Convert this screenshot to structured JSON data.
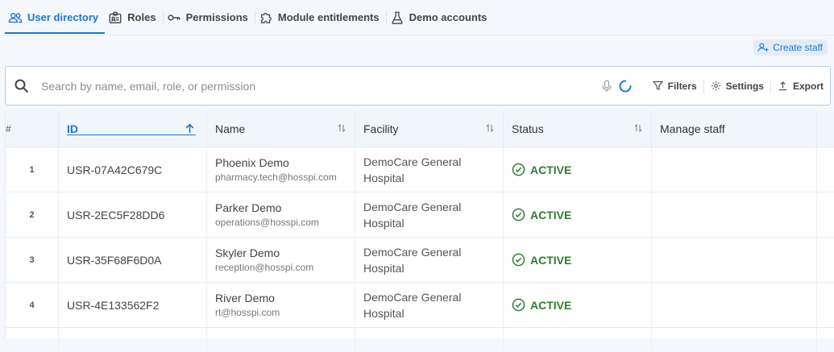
{
  "tabs": [
    {
      "label": "User directory",
      "icon": "users-icon",
      "active": true
    },
    {
      "label": "Roles",
      "icon": "badge-icon",
      "active": false
    },
    {
      "label": "Permissions",
      "icon": "key-icon",
      "active": false
    },
    {
      "label": "Module entitlements",
      "icon": "puzzle-icon",
      "active": false
    },
    {
      "label": "Demo accounts",
      "icon": "flask-icon",
      "active": false
    }
  ],
  "create_button": {
    "label": "Create staff",
    "icon": "add-user-icon"
  },
  "search": {
    "placeholder": "Search by name, email, role, or permission"
  },
  "toolbar": {
    "filters": "Filters",
    "settings": "Settings",
    "export": "Export"
  },
  "columns": {
    "index": "#",
    "id": "ID",
    "name": "Name",
    "facility": "Facility",
    "status": "Status",
    "manage": "Manage staff"
  },
  "rows": [
    {
      "index": "1",
      "id": "USR-07A42C679C",
      "name": "Phoenix Demo",
      "email": "pharmacy.tech@hosspi.com",
      "facility_line1": "DemoCare General",
      "facility_line2": "Hospital",
      "status": "ACTIVE"
    },
    {
      "index": "2",
      "id": "USR-2EC5F28DD6",
      "name": "Parker Demo",
      "email": "operations@hosspi.com",
      "facility_line1": "DemoCare General",
      "facility_line2": "Hospital",
      "status": "ACTIVE"
    },
    {
      "index": "3",
      "id": "USR-35F68F6D0A",
      "name": "Skyler Demo",
      "email": "reception@hosspi.com",
      "facility_line1": "DemoCare General",
      "facility_line2": "Hospital",
      "status": "ACTIVE"
    },
    {
      "index": "4",
      "id": "USR-4E133562F2",
      "name": "River Demo",
      "email": "rt@hosspi.com",
      "facility_line1": "DemoCare General",
      "facility_line2": "Hospital",
      "status": "ACTIVE"
    }
  ],
  "colors": {
    "accent": "#1976d2",
    "active_status": "#2e7d32"
  }
}
